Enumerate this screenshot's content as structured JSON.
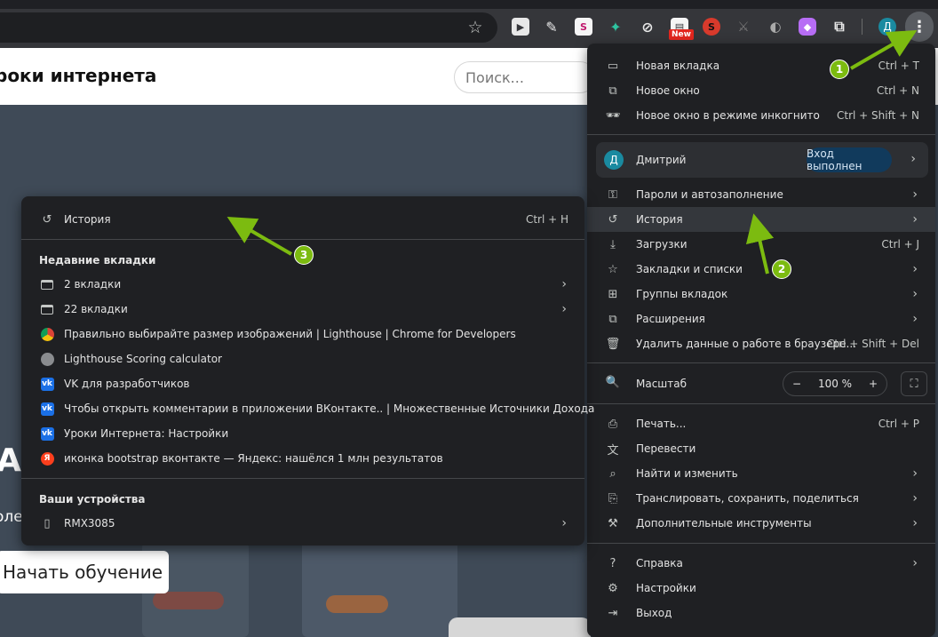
{
  "toolbar": {
    "profile_initial": "Д",
    "new_badge": "New",
    "extensions": [
      {
        "name": "kebab-ext-icon",
        "bg": "#35363a"
      }
    ]
  },
  "page": {
    "site_title": "роки интернета",
    "search_placeholder": "Поиск...",
    "hero_heading": "А",
    "hero_sub": "оле",
    "cta_label": "Начать обучение"
  },
  "main_menu": {
    "new_tab": {
      "label": "Новая вкладка",
      "shortcut": "Ctrl + T"
    },
    "new_window": {
      "label": "Новое окно",
      "shortcut": "Ctrl + N"
    },
    "incognito": {
      "label": "Новое окно в режиме инкогнито",
      "shortcut": "Ctrl + Shift + N"
    },
    "profile": {
      "initial": "Д",
      "name": "Дмитрий",
      "status": "Вход выполнен"
    },
    "passwords": {
      "label": "Пароли и автозаполнение"
    },
    "history": {
      "label": "История"
    },
    "downloads": {
      "label": "Загрузки",
      "shortcut": "Ctrl + J"
    },
    "bookmarks": {
      "label": "Закладки и списки"
    },
    "tab_groups": {
      "label": "Группы вкладок"
    },
    "extensions": {
      "label": "Расширения"
    },
    "clear_data": {
      "label": "Удалить данные о работе в браузере...",
      "shortcut": "Ctrl + Shift + Del"
    },
    "zoom": {
      "label": "Масштаб",
      "minus": "−",
      "value": "100 %",
      "plus": "+"
    },
    "print": {
      "label": "Печать...",
      "shortcut": "Ctrl + P"
    },
    "translate": {
      "label": "Перевести"
    },
    "find": {
      "label": "Найти и изменить"
    },
    "cast": {
      "label": "Транслировать, сохранить, поделиться"
    },
    "more_tools": {
      "label": "Дополнительные инструменты"
    },
    "help": {
      "label": "Справка"
    },
    "settings": {
      "label": "Настройки"
    },
    "exit": {
      "label": "Выход"
    }
  },
  "history_menu": {
    "history": {
      "label": "История",
      "shortcut": "Ctrl + H"
    },
    "recent_tabs_title": "Недавние вкладки",
    "recent_items": [
      {
        "label": "2 вкладки",
        "icon": "tabs-icon",
        "submenu": true
      },
      {
        "label": "22 вкладки",
        "icon": "tabs-icon",
        "submenu": true
      },
      {
        "label": "Правильно выбирайте размер изображений  |  Lighthouse  |  Chrome for Developers",
        "icon": "chrome-favicon-icon"
      },
      {
        "label": "Lighthouse Scoring calculator",
        "icon": "globe-favicon-icon"
      },
      {
        "label": "VK для разработчиков",
        "icon": "vk-favicon-icon"
      },
      {
        "label": "Чтобы открыть комментарии в приложении ВКонтакте.. | Множественные Источники Дохода",
        "icon": "vk-favicon-icon"
      },
      {
        "label": "Уроки Интернета: Настройки",
        "icon": "vk-favicon-icon"
      },
      {
        "label": "иконка bootstrap вконтакте — Яндекс: нашёлся 1 млн результатов",
        "icon": "yandex-favicon-icon"
      }
    ],
    "devices_title": "Ваши устройства",
    "device": {
      "label": "RMX3085"
    }
  },
  "annotations": {
    "step1": "1",
    "step2": "2",
    "step3": "3",
    "arrow_color": "#7cbb10"
  }
}
